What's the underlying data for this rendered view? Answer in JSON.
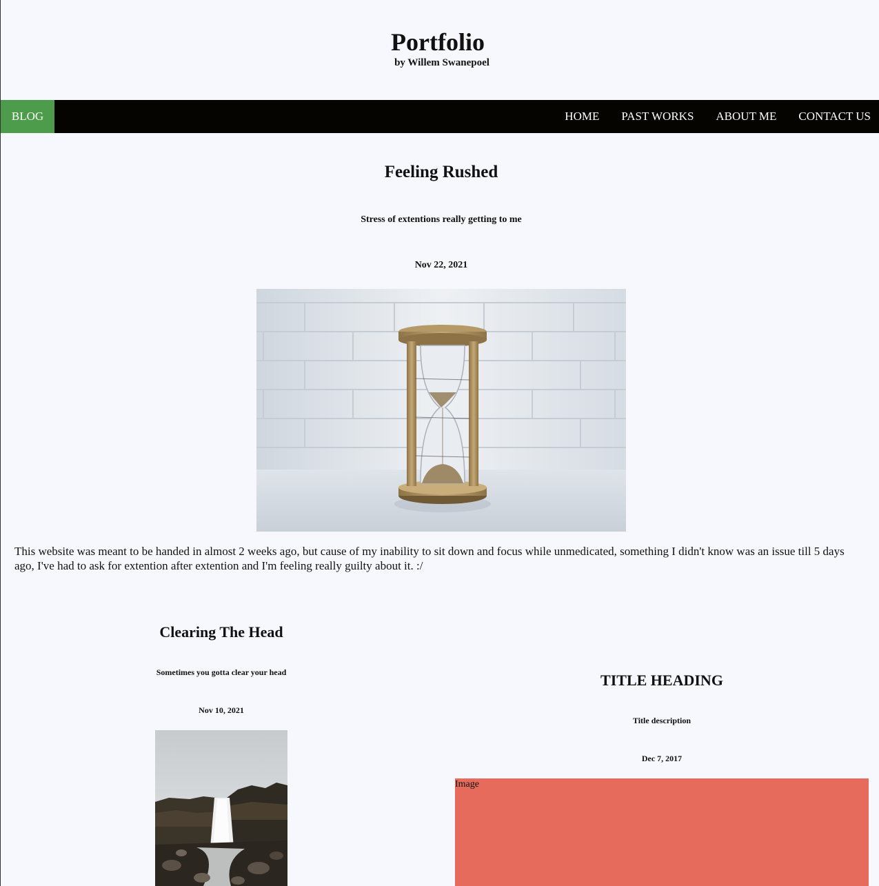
{
  "header": {
    "title": "Portfolio",
    "subtitle": "by Willem Swanepoel"
  },
  "nav": {
    "active": "BLOG",
    "items": [
      "HOME",
      "PAST WORKS",
      "ABOUT ME",
      "CONTACT US"
    ]
  },
  "featured_post": {
    "title": "Feeling Rushed",
    "description": "Stress of extentions really getting to me",
    "date": "Nov 22, 2021",
    "body": "This website was meant to be handed in almost 2 weeks ago, but cause of my inability to sit down and focus while unmedicated, something I didn't know was an issue till 5 days ago, I've had to ask for extention after extention and I'm feeling really guilty about it. :/"
  },
  "cards": [
    {
      "title": "Clearing The Head",
      "description": "Sometimes you gotta clear your head",
      "date": "Nov 10, 2021"
    },
    {
      "title": "TITLE HEADING",
      "description": "Title description",
      "date": "Dec 7, 2017",
      "image_label": "Image"
    }
  ],
  "colors": {
    "background": "#f7f8fe",
    "nav_background": "#050400",
    "nav_active": "#4c9c4c",
    "placeholder_image": "#e66b5c"
  }
}
